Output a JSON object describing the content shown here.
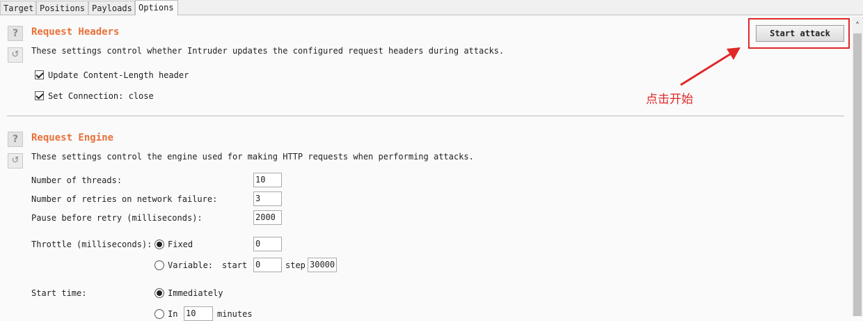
{
  "tabs": [
    "Target",
    "Positions",
    "Payloads",
    "Options"
  ],
  "active_tab": "Options",
  "headers_section": {
    "title": "Request Headers",
    "description": "These settings control whether Intruder updates the configured request headers during attacks.",
    "options": [
      {
        "label": "Update Content-Length header",
        "checked": true
      },
      {
        "label": "Set Connection: close",
        "checked": true
      }
    ]
  },
  "engine_section": {
    "title": "Request Engine",
    "description": "These settings control the engine used for making HTTP requests when performing attacks.",
    "threads_label": "Number of threads:",
    "threads_value": "10",
    "retries_label": "Number of retries on network failure:",
    "retries_value": "3",
    "pause_label": "Pause before retry (milliseconds):",
    "pause_value": "2000",
    "throttle_label": "Throttle (milliseconds):",
    "throttle_fixed_label": "Fixed",
    "throttle_fixed_value": "0",
    "throttle_variable_label": "Variable:",
    "variable_start_label": "start",
    "variable_start_value": "0",
    "variable_step_label": "step",
    "variable_step_value": "30000",
    "start_time_label": "Start time:",
    "immediately_label": "Immediately",
    "in_label": "In",
    "in_value": "10",
    "minutes_label": "minutes"
  },
  "start_attack_label": "Start attack",
  "annotation_text": "点击开始",
  "colors": {
    "section_title": "#e8713a",
    "annotation": "#e02828"
  }
}
